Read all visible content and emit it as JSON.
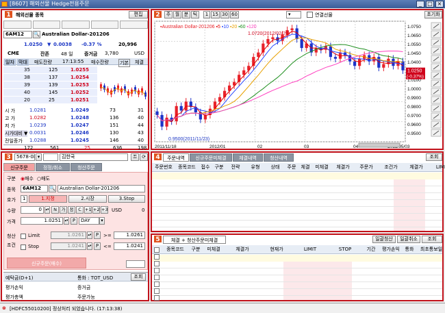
{
  "window": {
    "title": "[8607] 해외선물 Hedge전용주문",
    "icon": "app-icon"
  },
  "panel1": {
    "title": "해외선물 종목",
    "edit": "편집",
    "code": "6AM12",
    "name": "Australian Dollar-201206",
    "price": "1.0250",
    "arrow": "▼",
    "change": "0.0038",
    "pct": "-0.37 %",
    "volume": "20,996",
    "exchange": "CME",
    "remain_label": "잔존",
    "remain_val": "48 일",
    "margin_label": "증거금",
    "margin_val": "3,780",
    "currency": "USD",
    "tabs": [
      "일자",
      "막대"
    ],
    "ob_headers": [
      "매도잔량",
      "17:13:55",
      "매수잔량",
      "기본",
      "체결"
    ],
    "asks": [
      {
        "q": "35",
        "c": "125",
        "p": "1.0255"
      },
      {
        "q": "38",
        "c": "137",
        "p": "1.0254"
      },
      {
        "q": "39",
        "c": "139",
        "p": "1.0253"
      },
      {
        "q": "40",
        "c": "145",
        "p": "1.0252"
      },
      {
        "q": "20",
        "c": "25",
        "p": "1.0251"
      }
    ],
    "bids": [
      {
        "p": "1.0249",
        "c": "73",
        "q": "31"
      },
      {
        "p": "1.0248",
        "c": "136",
        "q": "40"
      },
      {
        "p": "1.0247",
        "c": "151",
        "q": "44"
      },
      {
        "p": "1.0246",
        "c": "130",
        "q": "43"
      },
      {
        "p": "1.0245",
        "c": "146",
        "q": "40"
      }
    ],
    "info": [
      {
        "l": "시   가",
        "v": "1.0281"
      },
      {
        "l": "고   가",
        "v": "1.0282"
      },
      {
        "l": "저   가",
        "v": "1.0239"
      },
      {
        "l": "시가대비 ▼",
        "v": "0.0031"
      },
      {
        "l": "전일종가",
        "v": "1.0288"
      }
    ],
    "totals": [
      "172",
      "561",
      "25",
      "636",
      "198"
    ]
  },
  "panel2": {
    "toolbar": [
      "주",
      "월",
      "분",
      "틱",
      "1",
      "15",
      "30",
      "60"
    ],
    "link_label": "연결선물",
    "reset": "초기화",
    "legend_name": "Australian Dollar-201206",
    "ma": [
      "5",
      "10",
      "20",
      "60",
      "120"
    ],
    "high_note": "1.0720(2012/02/29)",
    "low_note": "0.9500(2011/11/23)",
    "price_tag": "1.0250",
    "pct_tag": "(-0.37%)",
    "yticks": [
      "1.0750",
      "1.0650",
      "1.0550",
      "1.0450",
      "1.0400",
      "1.0250",
      "1.0100",
      "1.0000",
      "0.9900",
      "0.9800",
      "0.9700",
      "0.9600",
      "0.9500"
    ],
    "xticks": [
      "2011/11/18",
      "2012/01",
      "02",
      "03",
      "04",
      "2012/05/03"
    ]
  },
  "panel3": {
    "account": "5678-08",
    "owner": "김한국",
    "tabs": [
      "신규주문",
      "정정/취소",
      "청산주문"
    ],
    "side_label": "구분",
    "sell": "매수",
    "buy": "매도",
    "code_label": "종목",
    "code": "6AM12",
    "code_name": "Australian Dollar-201206",
    "type_label": "호가",
    "types": [
      "1.지정",
      "2.시장",
      "3.Stop"
    ],
    "qty_label": "수량",
    "qty": "0",
    "qty_btns": [
      "N",
      "가",
      "정",
      "C",
      "+1",
      "+2",
      "+3"
    ],
    "qty_unit": "USD",
    "qty_right": "0",
    "price_label": "가격",
    "price": "1.0251",
    "p": "P",
    "validity": "DAY",
    "liq_label": "청산",
    "cond_label": "조건",
    "limit": "Limit",
    "stop": "Stop",
    "limit_price": "1.0261",
    "stop_price": "1.0241",
    "limit_cmp": ">=",
    "stop_cmp": "<=",
    "limit_right": "1.0261",
    "stop_right": "1.0241",
    "submit": "신규주문(매수)",
    "bottom": [
      {
        "l": "예탁금(D+1)",
        "r": "통화 : TOT_USD",
        "b": "조회"
      },
      {
        "l": "평가손익",
        "r": "증거금"
      },
      {
        "l": "평가총액",
        "r": "주문가능"
      }
    ]
  },
  "panel4": {
    "tabs": [
      "주문내역",
      "신규주문미체결",
      "체결내역",
      "청산내역"
    ],
    "query": "조회",
    "headers": [
      "주문번호",
      "종목코드",
      "접수",
      "구분",
      "전략",
      "유형",
      "상태",
      "주문",
      "체결",
      "미체결",
      "체결가",
      "주문가",
      "조건가",
      "체결가",
      "LIMIT"
    ]
  },
  "panel5": {
    "tab": "체결 + 청산주문미체결",
    "btns": [
      "일괄청산",
      "일괄취소",
      "조회"
    ],
    "headers": [
      "종목코드",
      "구분",
      "미체결",
      "체결가",
      "현재가",
      "LIMIT",
      "STOP",
      "기간",
      "평가손익",
      "통화",
      "최초통보일"
    ]
  },
  "status": {
    "text": "[HDFC55010200] 정상처리 되었습니다. (17:13:38)"
  },
  "chart_data": {
    "type": "candlestick",
    "title": "Australian Dollar-201206",
    "x": [
      "2011/11/18",
      "2012/01",
      "02",
      "03",
      "04",
      "2012/05/03"
    ],
    "ylim": [
      0.945,
      1.08
    ],
    "high": 1.072,
    "low": 0.95,
    "last": 1.025,
    "closes": [
      0.975,
      0.962,
      0.972,
      0.968,
      0.985,
      0.98,
      0.99,
      0.984,
      0.978,
      0.97,
      0.975,
      0.982,
      0.99,
      0.995,
      1.002,
      1.008,
      1.012,
      1.02,
      1.025,
      1.03,
      1.04,
      1.045,
      1.055,
      1.06,
      1.062,
      1.058,
      1.065,
      1.07,
      1.072,
      1.06,
      1.05,
      1.055,
      1.045,
      1.05,
      1.048,
      1.052,
      1.04,
      1.038,
      1.045,
      1.042,
      1.035,
      1.03,
      1.038,
      1.042,
      1.035,
      1.04,
      1.028,
      1.032,
      1.038,
      1.03,
      1.035,
      1.025
    ],
    "colors": {
      "up": "#e8222a",
      "down": "#1d33c8",
      "ma5": "#e60000",
      "ma10": "#2646ff",
      "ma20": "#e8a000",
      "ma60": "#1f8f1f",
      "ma120": "#ff40c0"
    }
  }
}
